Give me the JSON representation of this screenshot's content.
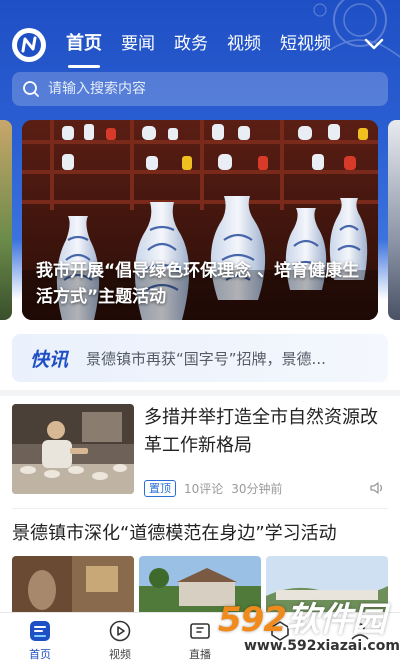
{
  "header": {
    "tabs": [
      {
        "label": "首页",
        "active": true
      },
      {
        "label": "要闻",
        "active": false
      },
      {
        "label": "政务",
        "active": false
      },
      {
        "label": "视频",
        "active": false
      },
      {
        "label": "短视频",
        "active": false
      }
    ],
    "more_icon": "chevron-down-icon",
    "logo_icon": "app-logo-icon"
  },
  "search": {
    "placeholder": "请输入搜索内容",
    "icon": "search-icon"
  },
  "banner": {
    "title": "我市开展“倡导绿色环保理念 、培育健康生活方式”主题活动"
  },
  "flash_news": {
    "label": "快讯",
    "text": "景德镇市再获“国字号”招牌，景德..."
  },
  "articles": [
    {
      "title": "多措并举打造全市自然资源改革工作新格局",
      "badge": "置顶",
      "comments": "10评论",
      "time": "30分钟前"
    },
    {
      "title": "景德镇市深化“道德模范在身边”学习活动"
    }
  ],
  "bottom_nav": [
    {
      "label": "首页",
      "icon": "home-icon",
      "active": true
    },
    {
      "label": "视频",
      "icon": "play-icon",
      "active": false
    },
    {
      "label": "直播",
      "icon": "tv-icon",
      "active": false
    },
    {
      "label": "",
      "icon": "service-icon",
      "active": false
    },
    {
      "label": "",
      "icon": "user-icon",
      "active": false
    }
  ],
  "watermark": {
    "number": "592",
    "brand": "软件园",
    "url": "www.592xiazai.com"
  },
  "colors": {
    "brand_blue": "#1f4fc4",
    "text_dark": "#222222",
    "text_gray": "#999999",
    "badge_blue": "#2a6fd8"
  }
}
